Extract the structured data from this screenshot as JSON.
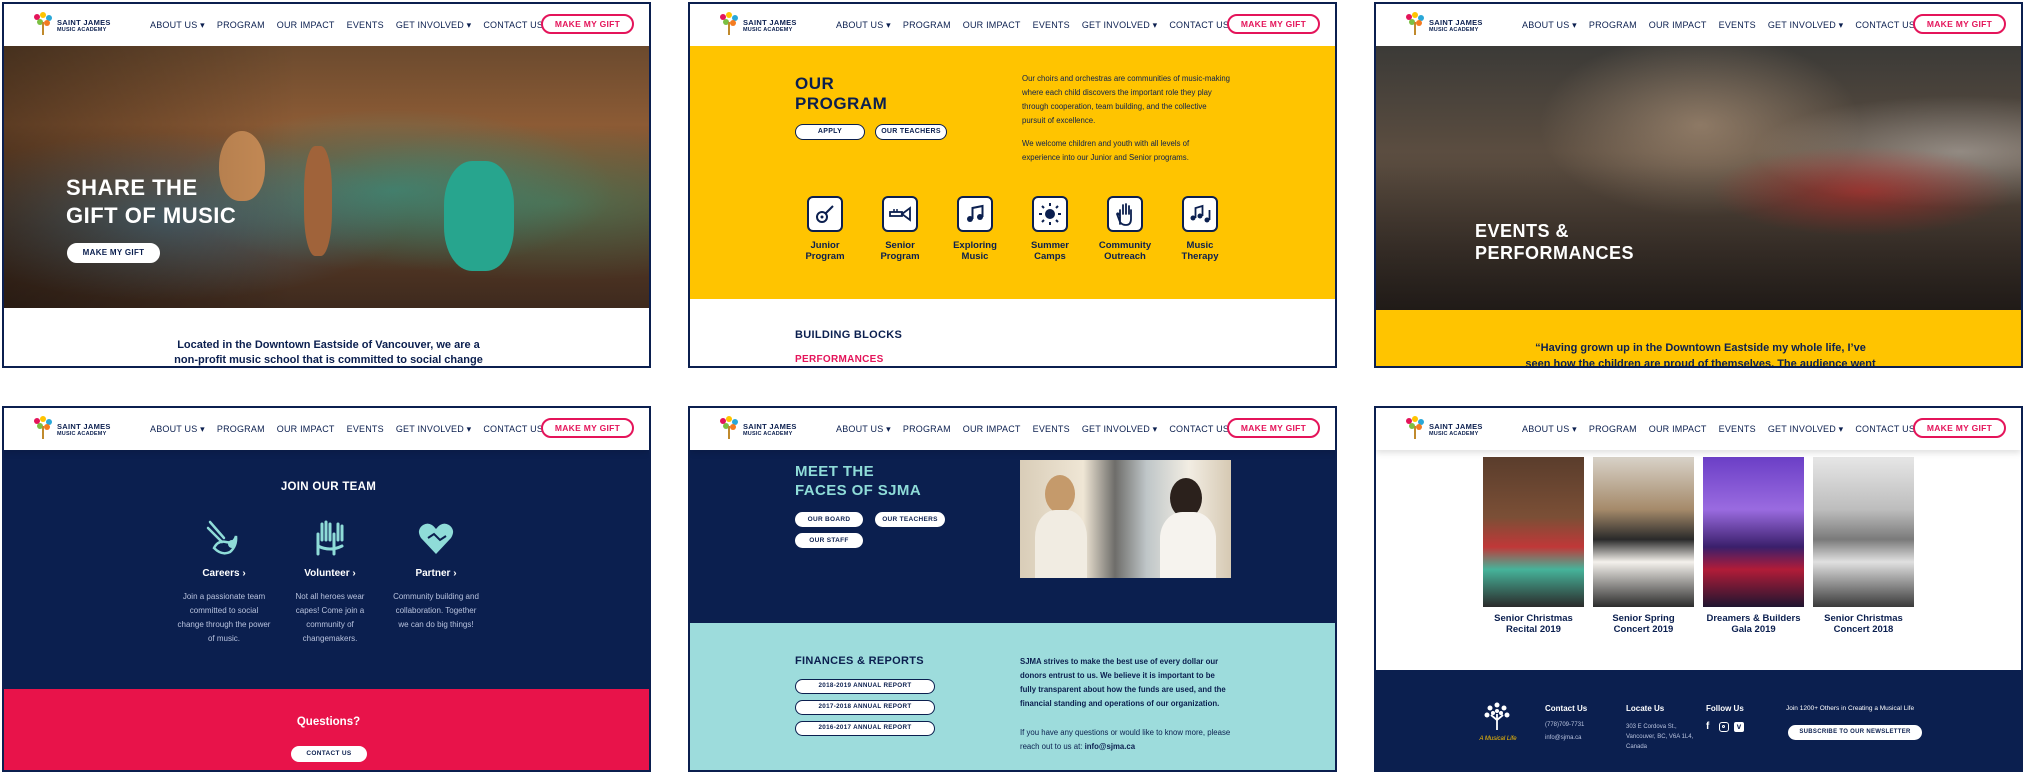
{
  "nav": {
    "logo_line1": "SAINT JAMES",
    "logo_line2": "MUSIC ACADEMY",
    "about": "ABOUT US ▾",
    "program": "PROGRAM",
    "impact": "OUR IMPACT",
    "events": "EVENTS",
    "get_involved": "GET INVOLVED ▾",
    "contact": "CONTACT US",
    "gift": "MAKE MY GIFT"
  },
  "p1": {
    "hero_line1": "SHARE THE",
    "hero_line2": "GIFT OF MUSIC",
    "cta": "MAKE MY GIFT",
    "intro_line1": "Located in the Downtown Eastside of Vancouver, we are a",
    "intro_line2": "non-profit music school that is committed to social change"
  },
  "p2": {
    "title_line1": "OUR",
    "title_line2": "PROGRAM",
    "apply": "APPLY",
    "teachers": "OUR TEACHERS",
    "para1": "Our choirs and orchestras are communities of music-making where each child discovers the important role they play through cooperation, team building, and the collective pursuit of excellence.",
    "para2": "We welcome children and youth with all levels of experience into our Junior and Senior programs.",
    "programs": [
      {
        "icon": "guitar-icon",
        "line1": "Junior",
        "line2": "Program"
      },
      {
        "icon": "trumpet-icon",
        "line1": "Senior",
        "line2": "Program"
      },
      {
        "icon": "music-notes-icon",
        "line1": "Exploring",
        "line2": "Music"
      },
      {
        "icon": "sun-icon",
        "line1": "Summer",
        "line2": "Camps"
      },
      {
        "icon": "hand-icon",
        "line1": "Community",
        "line2": "Outreach"
      },
      {
        "icon": "notes-therapy-icon",
        "line1": "Music",
        "line2": "Therapy"
      }
    ],
    "section": "BUILDING BLOCKS",
    "sub": "PERFORMANCES"
  },
  "p3": {
    "hero_line1": "EVENTS &",
    "hero_line2": "PERFORMANCES",
    "quote_line1": "“Having grown up in the Downtown Eastside my whole life, I’ve",
    "quote_line2": "seen how the children are proud of themselves. The audience went"
  },
  "p4": {
    "title": "JOIN OUR TEAM",
    "items": [
      {
        "icon": "hands-spark-icon",
        "label": "Careers ›",
        "text": "Join a passionate team committed to social change through the power of music."
      },
      {
        "icon": "raised-hands-icon",
        "label": "Volunteer ›",
        "text": "Not all heroes wear capes! Come join a community of changemakers."
      },
      {
        "icon": "heart-handshake-icon",
        "label": "Partner ›",
        "text": "Community building and collaboration. Together we can do big things!"
      }
    ],
    "questions": "Questions?",
    "contact": "CONTACT US"
  },
  "p5": {
    "title_line1": "MEET THE",
    "title_line2": "FACES OF SJMA",
    "board": "OUR BOARD",
    "teachers": "OUR TEACHERS",
    "staff": "OUR STAFF",
    "finances": "FINANCES & REPORTS",
    "reports": [
      "2018-2019 ANNUAL REPORT",
      "2017-2018 ANNUAL REPORT",
      "2016-2017 ANNUAL REPORT"
    ],
    "fin_text": "SJMA strives to make the best use of every dollar our donors entrust to us. We believe it is important to be fully transparent about how the funds are used, and the financial standing and operations of our organization.",
    "fin_q": "If you have any questions or would like to know more, please reach out to us at:",
    "fin_email": "info@sjma.ca"
  },
  "p6": {
    "events": [
      {
        "line1": "Senior Christmas",
        "line2": "Recital 2019"
      },
      {
        "line1": "Senior Spring",
        "line2": "Concert 2019"
      },
      {
        "line1": "Dreamers & Builders",
        "line2": "Gala 2019"
      },
      {
        "line1": "Senior Christmas",
        "line2": "Concert 2018"
      }
    ],
    "tagline": "A Musical Life",
    "contact_h": "Contact Us",
    "phone": "(778)709-7731",
    "email": "info@sjma.ca",
    "locate_h": "Locate Us",
    "addr1": "303 E Cordova St.,",
    "addr2": "Vancouver, BC, V6A 1L4,",
    "addr3": "Canada",
    "follow_h": "Follow Us",
    "join": "Join 1200+ Others in Creating a Musical Life",
    "subscribe": "SUBSCRIBE TO OUR NEWSLETTER"
  },
  "colors": {
    "navy": "#0b1f4f",
    "yellow": "#ffc400",
    "pink": "#e4145a",
    "teal": "#9ddcdc",
    "red": "#e8134a"
  }
}
